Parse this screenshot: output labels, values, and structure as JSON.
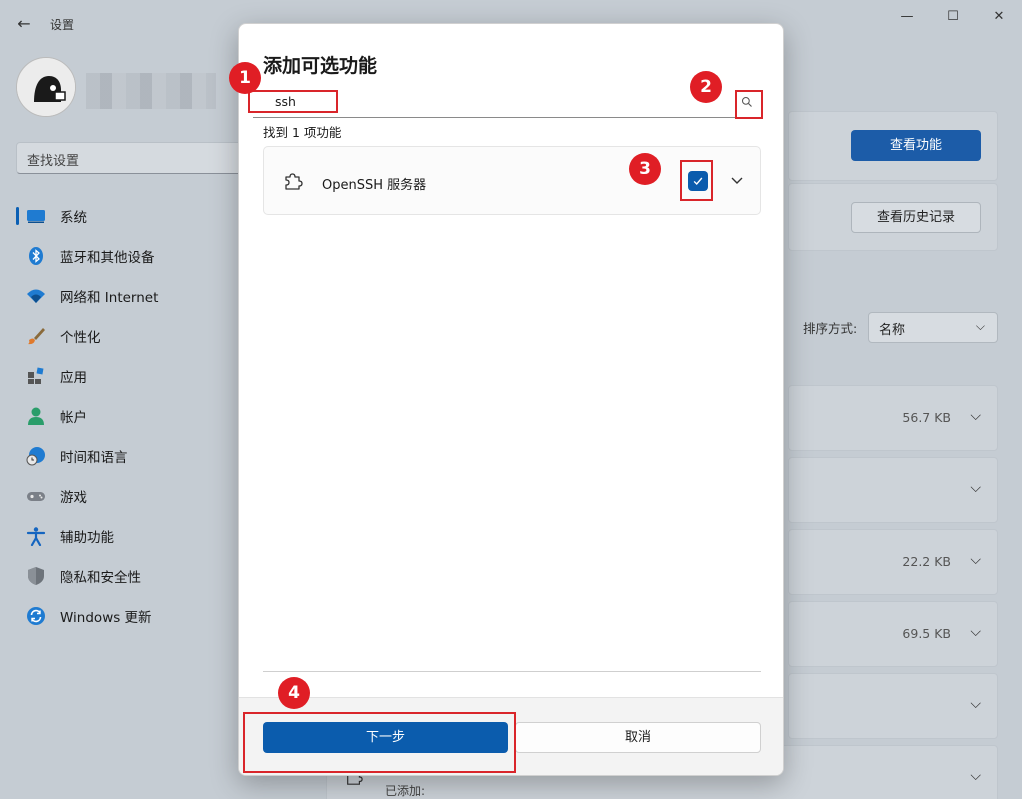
{
  "app": {
    "title": "设置",
    "back_icon": "back-arrow-icon",
    "controls": [
      "minimize-icon",
      "maximize-icon",
      "close-icon"
    ]
  },
  "sidebar": {
    "search_placeholder": "查找设置",
    "items": [
      {
        "label": "系统",
        "icon": "monitor-icon",
        "active": true
      },
      {
        "label": "蓝牙和其他设备",
        "icon": "bluetooth-icon",
        "active": false
      },
      {
        "label": "网络和 Internet",
        "icon": "wifi-icon",
        "active": false
      },
      {
        "label": "个性化",
        "icon": "brush-icon",
        "active": false
      },
      {
        "label": "应用",
        "icon": "apps-icon",
        "active": false
      },
      {
        "label": "帐户",
        "icon": "person-icon",
        "active": false
      },
      {
        "label": "时间和语言",
        "icon": "globe-clock-icon",
        "active": false
      },
      {
        "label": "游戏",
        "icon": "gamepad-icon",
        "active": false
      },
      {
        "label": "辅助功能",
        "icon": "accessibility-icon",
        "active": false
      },
      {
        "label": "隐私和安全性",
        "icon": "shield-icon",
        "active": false
      },
      {
        "label": "Windows 更新",
        "icon": "update-icon",
        "active": false
      }
    ]
  },
  "background": {
    "view_features_button": "查看功能",
    "view_history_button": "查看历史记录",
    "sort_label": "排序方式:",
    "sort_value": "名称",
    "rows": [
      {
        "size": "56.7 KB"
      },
      {
        "size": ""
      },
      {
        "size": "22.2 KB"
      },
      {
        "size": "69.5 KB"
      },
      {
        "size": ""
      }
    ],
    "added_label": "已添加:"
  },
  "dialog": {
    "title": "添加可选功能",
    "search_value": "ssh",
    "found_text": "找到 1 项功能",
    "feature": {
      "name": "OpenSSH 服务器",
      "checked": true
    },
    "next_button": "下一步",
    "cancel_button": "取消"
  },
  "annotations": {
    "steps": [
      "1",
      "2",
      "3",
      "4"
    ],
    "color": "#d9252a"
  },
  "colors": {
    "accent": "#0b5cad"
  }
}
